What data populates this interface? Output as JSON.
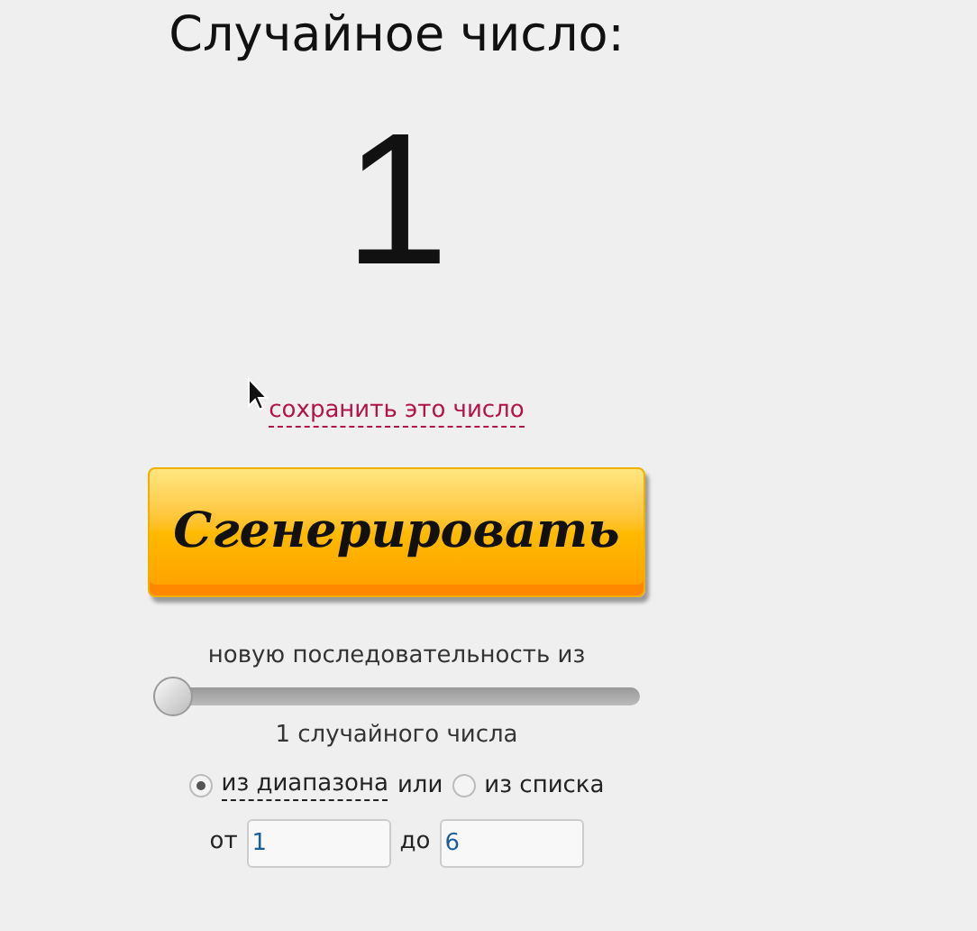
{
  "title": "Случайное число:",
  "result": "1",
  "save_link": "сохранить это число",
  "generate_button": "Сгенерировать",
  "sequence_label": "новую последовательность из",
  "count_slider": {
    "level": 0
  },
  "count_caption": "1 случайного числа",
  "source_options": [
    {
      "label": "из диапазона",
      "selected": true,
      "dashed": true
    },
    {
      "label": "из списка",
      "selected": false,
      "dashed": false
    }
  ],
  "source_joiner": "или",
  "range": [
    {
      "label": "от",
      "value": "1"
    },
    {
      "label": "до",
      "value": "6"
    }
  ]
}
